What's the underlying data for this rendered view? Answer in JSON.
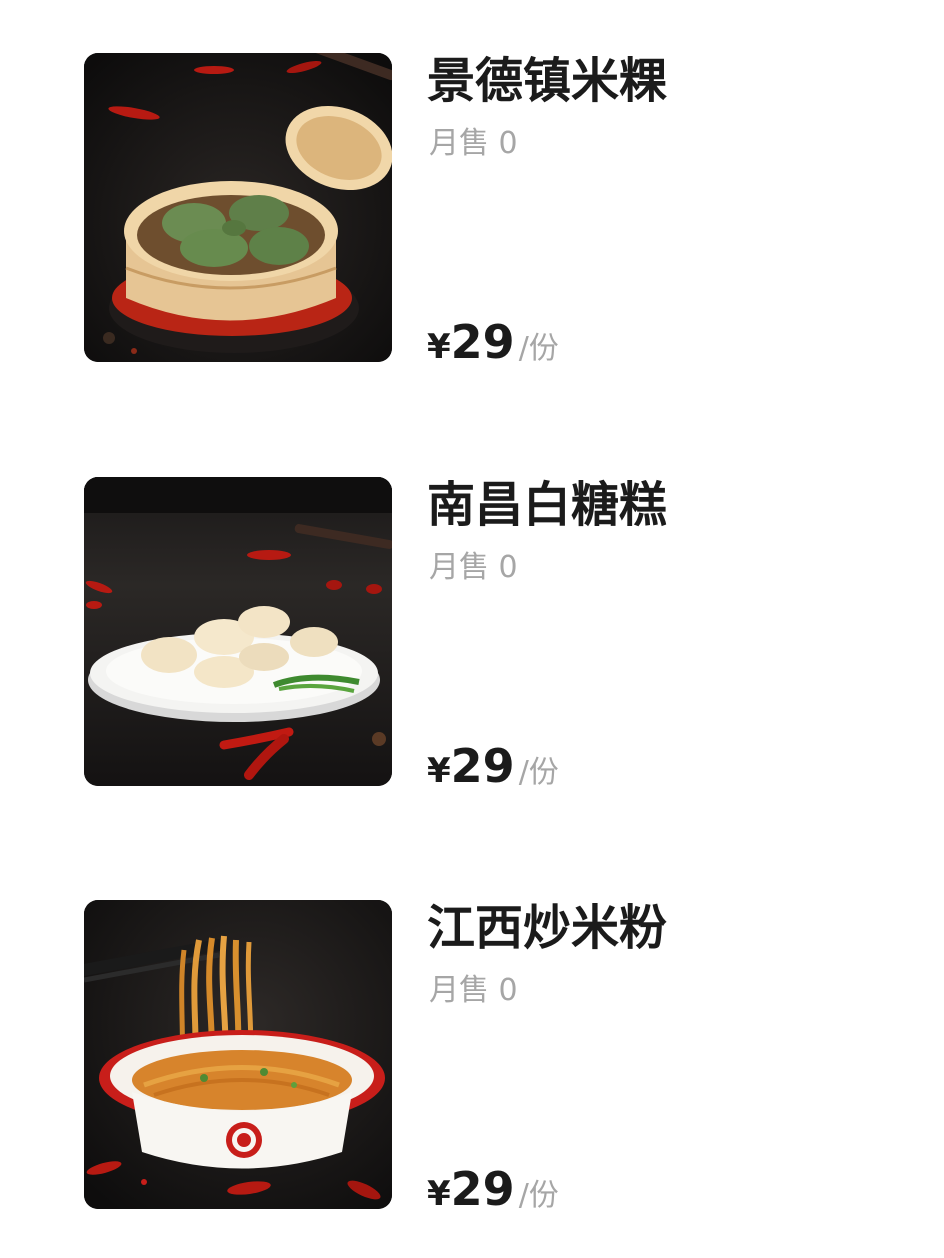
{
  "menu": {
    "items": [
      {
        "name": "景德镇米粿",
        "sales": "月售 0",
        "currency": "¥",
        "price": "29",
        "unit": "/份",
        "image_icon": "steamer-dumplings-photo"
      },
      {
        "name": "南昌白糖糕",
        "sales": "月售 0",
        "currency": "¥",
        "price": "29",
        "unit": "/份",
        "image_icon": "sugar-cake-plate-photo"
      },
      {
        "name": "江西炒米粉",
        "sales": "月售 0",
        "currency": "¥",
        "price": "29",
        "unit": "/份",
        "image_icon": "fried-rice-noodles-bowl-photo"
      }
    ]
  },
  "colors": {
    "title": "#1b1b1b",
    "muted": "#a6a6a6",
    "chili": "#c41a12",
    "photo_background": "#151313"
  }
}
